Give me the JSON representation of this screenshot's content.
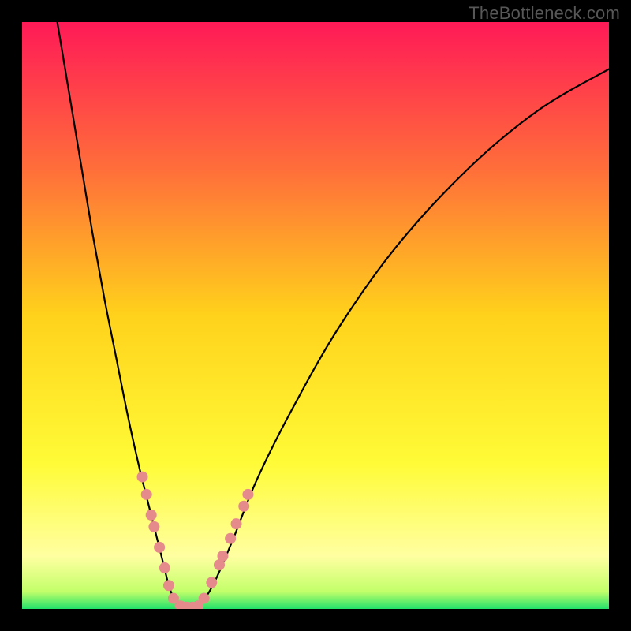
{
  "watermark": "TheBottleneck.com",
  "chart_data": {
    "type": "line",
    "title": "",
    "xlabel": "",
    "ylabel": "",
    "xlim": [
      0,
      100
    ],
    "ylim": [
      0,
      100
    ],
    "background_gradient": [
      {
        "y": 100,
        "color": "#ff1a57"
      },
      {
        "y": 75,
        "color": "#ff6e3a"
      },
      {
        "y": 50,
        "color": "#ffd21b"
      },
      {
        "y": 25,
        "color": "#fffb36"
      },
      {
        "y": 9,
        "color": "#ffffa1"
      },
      {
        "y": 3,
        "color": "#c3ff6a"
      },
      {
        "y": 0,
        "color": "#22e26b"
      }
    ],
    "series": [
      {
        "name": "left-curve",
        "x": [
          6,
          8,
          10,
          12,
          14,
          16,
          18,
          20,
          22,
          24,
          25,
          26,
          27
        ],
        "y": [
          100,
          88,
          76,
          64,
          53,
          43,
          33,
          24,
          16,
          8,
          4,
          1.5,
          0.5
        ]
      },
      {
        "name": "right-curve",
        "x": [
          30,
          31,
          33,
          36,
          40,
          46,
          54,
          64,
          76,
          88,
          100
        ],
        "y": [
          0.5,
          1.5,
          5,
          12,
          22,
          34,
          48,
          62,
          75,
          85,
          92
        ]
      },
      {
        "name": "valley-floor",
        "x": [
          27,
          28,
          29,
          30
        ],
        "y": [
          0.5,
          0.3,
          0.3,
          0.5
        ]
      }
    ],
    "markers": {
      "name": "dots",
      "color": "#e58b8b",
      "radius": 7,
      "points": [
        {
          "x": 20.5,
          "y": 22.5
        },
        {
          "x": 21.2,
          "y": 19.5
        },
        {
          "x": 22.0,
          "y": 16.0
        },
        {
          "x": 22.5,
          "y": 14.0
        },
        {
          "x": 23.4,
          "y": 10.5
        },
        {
          "x": 24.3,
          "y": 7.0
        },
        {
          "x": 25.0,
          "y": 4.0
        },
        {
          "x": 25.8,
          "y": 1.8
        },
        {
          "x": 27.0,
          "y": 0.5
        },
        {
          "x": 28.0,
          "y": 0.3
        },
        {
          "x": 29.0,
          "y": 0.3
        },
        {
          "x": 30.0,
          "y": 0.5
        },
        {
          "x": 31.0,
          "y": 1.8
        },
        {
          "x": 32.3,
          "y": 4.5
        },
        {
          "x": 33.6,
          "y": 7.5
        },
        {
          "x": 34.2,
          "y": 9.0
        },
        {
          "x": 35.5,
          "y": 12.0
        },
        {
          "x": 36.5,
          "y": 14.5
        },
        {
          "x": 37.8,
          "y": 17.5
        },
        {
          "x": 38.5,
          "y": 19.5
        }
      ]
    }
  }
}
